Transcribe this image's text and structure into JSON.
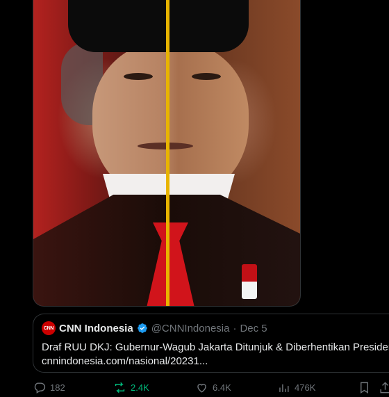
{
  "media": {
    "description_icon": "portrait-image"
  },
  "quote": {
    "logo_text": "CNN",
    "name": "CNN Indonesia",
    "handle": "@CNNIndonesia",
    "separator": "·",
    "date": "Dec 5",
    "line1": "Draf RUU DKJ: Gubernur-Wagub Jakarta Ditunjuk & Diberhentikan Presiden",
    "line2": "cnnindonesia.com/nasional/20231..."
  },
  "actions": {
    "replies": "182",
    "reposts": "2.4K",
    "likes": "6.4K",
    "views": "476K"
  },
  "colors": {
    "accent_verified": "#1d9bf0",
    "repost_active": "#00ba7c",
    "muted": "#71767b"
  }
}
